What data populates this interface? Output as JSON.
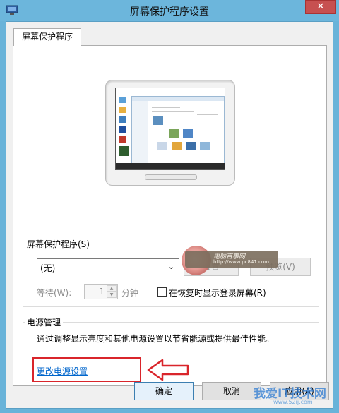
{
  "window": {
    "title": "屏幕保护程序设置",
    "close_glyph": "✕"
  },
  "tab": {
    "label": "屏幕保护程序"
  },
  "screensaver_group": {
    "legend": "屏幕保护程序(S)",
    "selected": "(无)",
    "settings_label": "设置",
    "preview_label": "预览(V)",
    "wait_label": "等待(W):",
    "wait_value": "1",
    "wait_unit": "分钟",
    "resume_label": "在恢复时显示登录屏幕(R)",
    "resume_checked": false
  },
  "power_group": {
    "legend": "电源管理",
    "description": "通过调整显示亮度和其他电源设置以节省能源或提供最佳性能。",
    "link": "更改电源设置"
  },
  "buttons": {
    "ok": "确定",
    "cancel": "取消",
    "apply": "应用(A)"
  },
  "watermarks": {
    "badge_text": "电脑百事网",
    "badge_url": "http://www.pc841.com",
    "footer_text": "我爱IT技术网",
    "footer_url": "www.52ij.com"
  },
  "colors": {
    "titlebar": "#6cb6dc",
    "close": "#c75050",
    "link": "#0066cc",
    "highlight": "#d9252b"
  },
  "icons": [
    "screensaver-app-icon",
    "close-icon",
    "chevron-down-icon",
    "spin-up-icon",
    "spin-down-icon",
    "arrow-left-icon"
  ]
}
